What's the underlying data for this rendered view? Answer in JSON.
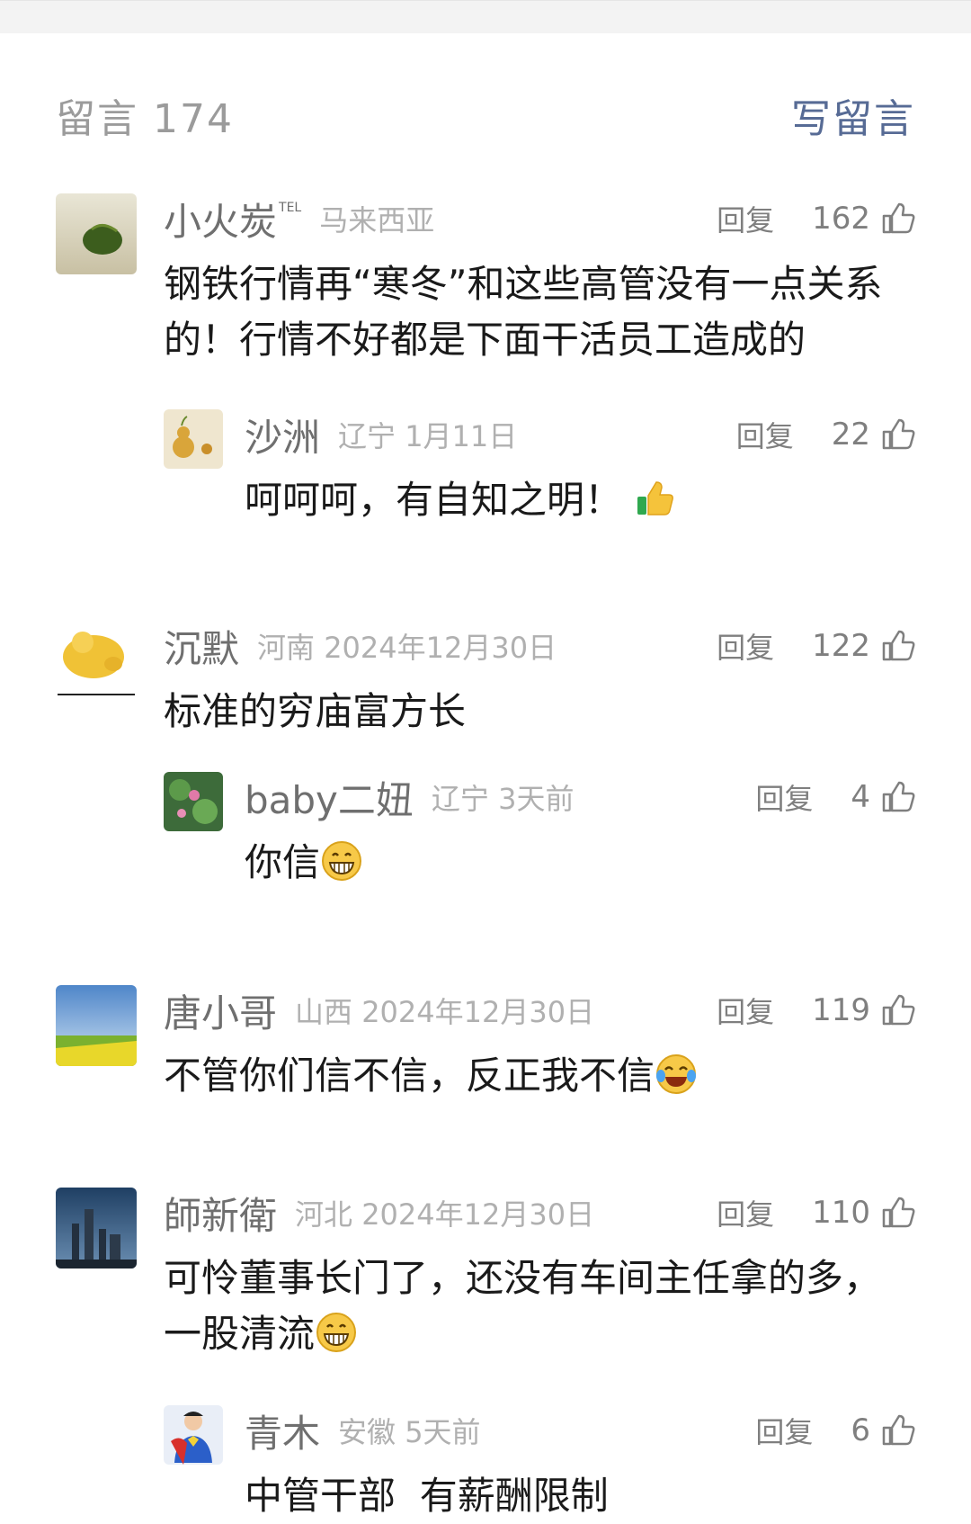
{
  "header": {
    "count_label": "留言 174",
    "write_label": "写留言"
  },
  "comments": [
    {
      "name": "小火炭",
      "tag": "TEL",
      "location": "马来西亚",
      "reply": "回复",
      "likes": "162",
      "text": "钢铁行情再“寒冬”和这些高管没有一点关系的！行情不好都是下面干活员工造成的",
      "replies": [
        {
          "name": "沙洲",
          "location": "辽宁 1月11日",
          "reply": "回复",
          "likes": "22",
          "text": "呵呵呵，有自知之明！",
          "emoji": "thumbs-up"
        }
      ]
    },
    {
      "name": "沉默",
      "location": "河南 2024年12月30日",
      "reply": "回复",
      "likes": "122",
      "text": "标准的穷庙富方长",
      "replies": [
        {
          "name": "baby二妞",
          "location": "辽宁 3天前",
          "reply": "回复",
          "likes": "4",
          "text": "你信",
          "emoji": "grin"
        }
      ]
    },
    {
      "name": "唐小哥",
      "location": "山西 2024年12月30日",
      "reply": "回复",
      "likes": "119",
      "text": "不管你们信不信，反正我不信",
      "emoji": "tears-of-joy"
    },
    {
      "name": "師新衛",
      "location": "河北 2024年12月30日",
      "reply": "回复",
      "likes": "110",
      "text": "可怜董事长门了，还没有车间主任拿的多，一股清流",
      "emoji": "grin",
      "replies": [
        {
          "name": "青木",
          "location": "安徽 5天前",
          "reply": "回复",
          "likes": "6",
          "text": "中管干部  有薪酬限制"
        }
      ]
    }
  ],
  "colors": {
    "link": "#576b95",
    "muted": "#9b9b9b",
    "text": "#1a1a1a"
  }
}
